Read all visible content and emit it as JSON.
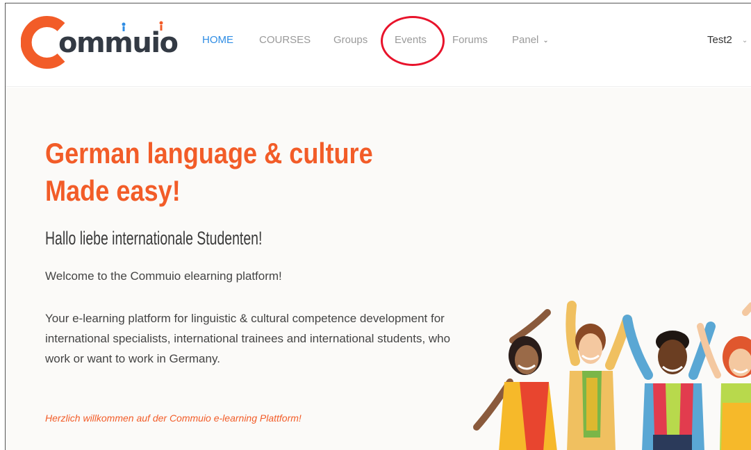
{
  "header": {
    "logo_text": "ommuio",
    "nav": [
      {
        "label": "HOME",
        "active": true
      },
      {
        "label": "COURSES",
        "active": false
      },
      {
        "label": "Groups",
        "active": false
      },
      {
        "label": "Events",
        "active": false
      },
      {
        "label": "Forums",
        "active": false
      },
      {
        "label": "Panel",
        "active": false,
        "has_dropdown": true
      }
    ],
    "user_menu": {
      "label": "Test2",
      "has_dropdown": true
    },
    "highlighted_item": "Events"
  },
  "hero": {
    "headline_line1": "German language & culture",
    "headline_line2": "Made easy!",
    "subtitle": "Hallo liebe internationale Studenten!",
    "welcome": "Welcome to the Commuio elearning platform!",
    "description": "Your e-learning platform for linguistic & cultural competence development for international specialists, international trainees and international students, who work or want to work in Germany.",
    "german_welcome": "Herzlich willkommen auf der Commuio e-learning Plattform!"
  },
  "colors": {
    "brand_orange": "#f25c28",
    "nav_active": "#2f8de4",
    "nav_inactive": "#9a9a9a",
    "annotation_red": "#e8132b",
    "hero_background": "#fbfaf8"
  },
  "icons": {
    "dropdown": "chevron-down-icon"
  }
}
